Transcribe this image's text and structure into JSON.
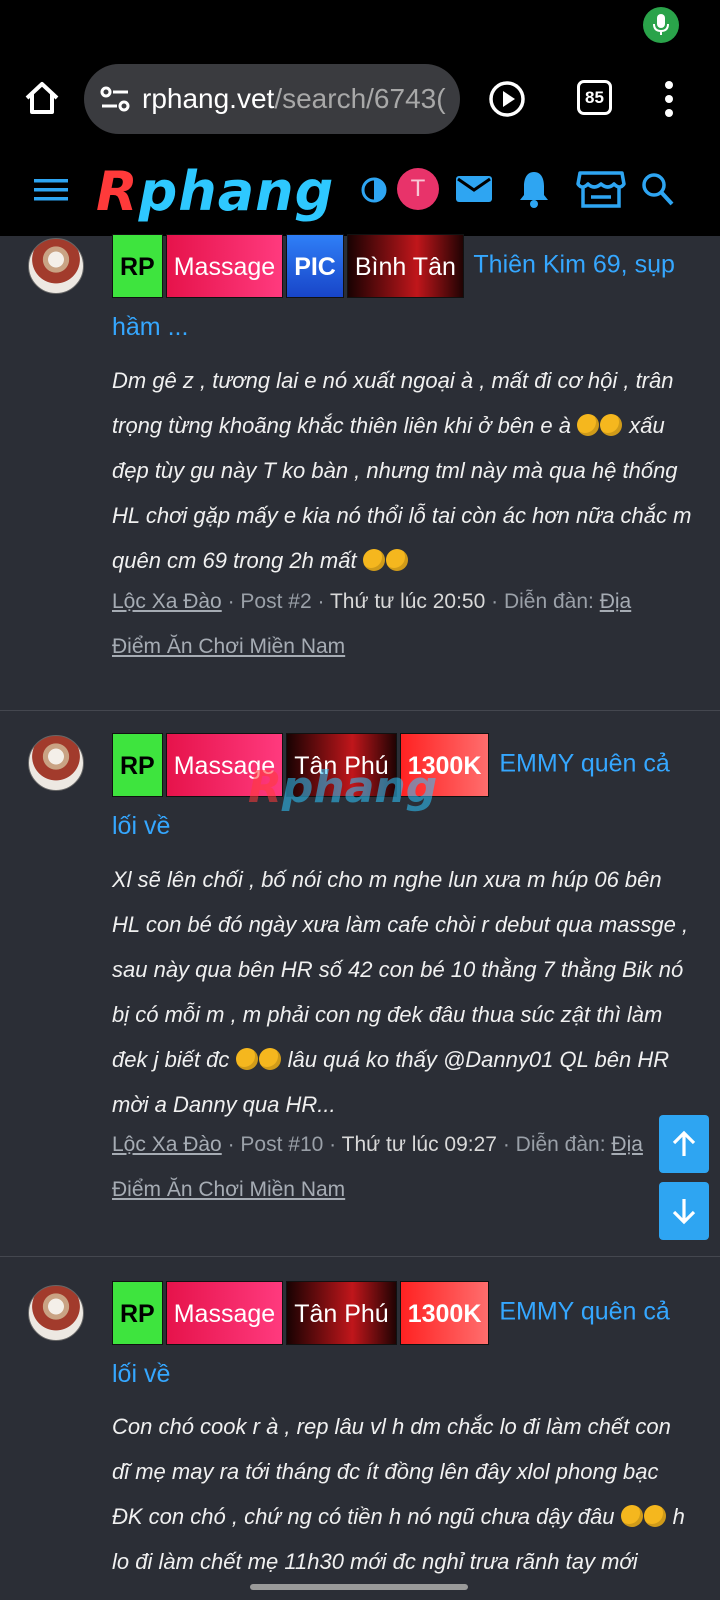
{
  "browser": {
    "url_host": "rphang.vet",
    "url_path": "/search/6743(",
    "tab_count": "85",
    "icons": [
      "mic-icon",
      "home-icon",
      "site-settings-icon",
      "play-icon",
      "tabs-icon",
      "more-icon"
    ]
  },
  "site_header": {
    "logo_first": "R",
    "logo_rest": "phang",
    "avatar_letter": "T",
    "icons": [
      "menu-icon",
      "contrast-icon",
      "mail-icon",
      "bell-icon",
      "store-icon",
      "search-icon"
    ]
  },
  "watermark": {
    "first": "R",
    "rest": "phang"
  },
  "posts": [
    {
      "tags": [
        "RP",
        "Massage",
        "PIC",
        "Bình Tân"
      ],
      "title": "Thiên Kim 69, sụp hầm ...",
      "body_parts": [
        "Dm gê z , tương lai e nó xuất ngoại à , mất đi cơ hội , trân trọng từng khoãng khắc thiên liên khi ở bên e à ",
        " xấu đẹp tùy gu này T ko bàn , nhưng tml này mà qua hệ thống HL chơi gặp mấy e kia nó thổi lỗ tai còn ác hơn nữa chắc m quên cm 69 trong 2h mất "
      ],
      "author": "Lộc Xa Đào",
      "post_no": "Post #2",
      "time": "Thứ tư lúc 20:50",
      "forum_label": "Diễn đàn:",
      "forum": "Địa Điểm Ăn Chơi Miền Nam"
    },
    {
      "tags": [
        "RP",
        "Massage",
        "Tân Phú",
        "1300K"
      ],
      "title": "EMMY quên cả lối về",
      "body_parts": [
        "Xl sẽ lên chối , bố nói cho m nghe lun xưa m húp 06 bên HL con bé đó ngày xưa làm cafe chòi r debut qua massge , sau này qua bên HR số 42 con bé 10 thằng 7 thằng Bik nó bị có mỗi m , m phải con ng đek đâu thua súc zật thì làm đek j biết đc ",
        " lâu quá ko thấy @Danny01 QL bên HR mời a Danny qua HR..."
      ],
      "author": "Lộc Xa Đào",
      "post_no": "Post #10",
      "time": "Thứ tư lúc 09:27",
      "forum_label": "Diễn đàn:",
      "forum": "Địa Điểm Ăn Chơi Miền Nam"
    },
    {
      "tags": [
        "RP",
        "Massage",
        "Tân Phú",
        "1300K"
      ],
      "title": "EMMY quên cả lối về",
      "body_parts": [
        "Con chó cook r à , rep lâu vl h dm chắc lo đi làm chết con dĩ mẹ may ra tới tháng đc ít đồng lên đây xlol phong bạc ĐK con chó , chứ ng có tiền h nó ngũ chưa dậy đâu ",
        " h lo đi làm chết mẹ 11h30 mới đc nghỉ trưa rãnh tay mới"
      ]
    }
  ]
}
